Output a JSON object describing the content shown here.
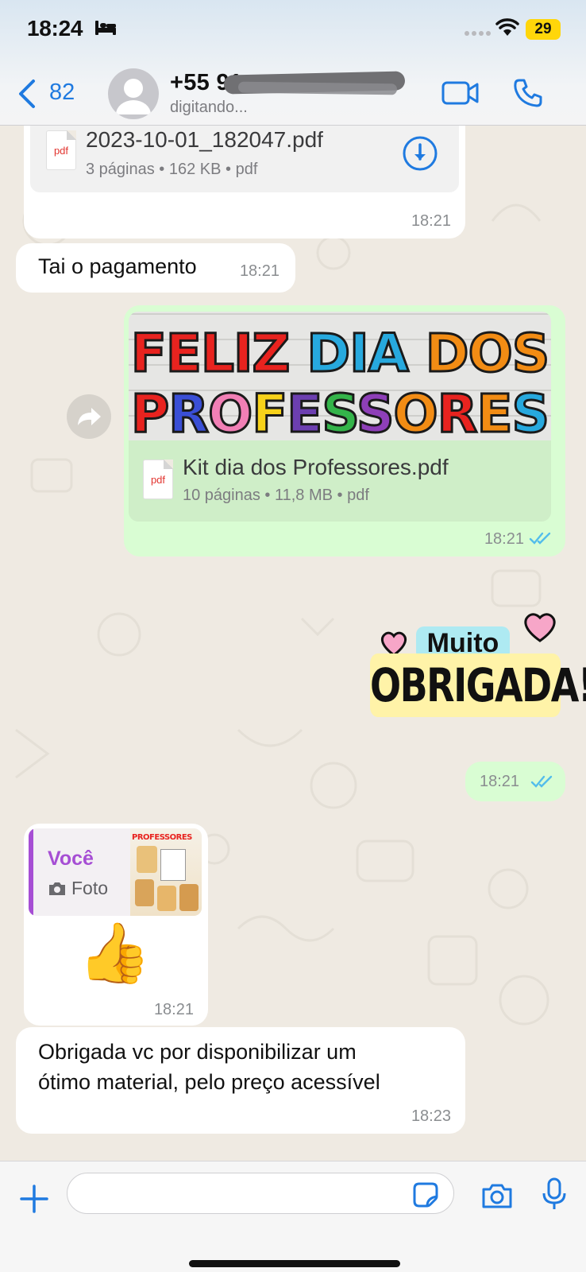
{
  "status_bar": {
    "time": "18:24",
    "battery": "29"
  },
  "header": {
    "back_count": "82",
    "contact_name": "+55 91",
    "contact_status": "digitando..."
  },
  "messages": {
    "file1": {
      "name": "2023-10-01_182047.pdf",
      "meta": "3 páginas • 162 KB • pdf",
      "icon_label": "pdf",
      "time": "18:21"
    },
    "text1": {
      "text": "Tai o pagamento",
      "time": "18:21"
    },
    "banner": {
      "line1": [
        "FELIZ",
        "DIA",
        "DOS"
      ],
      "line2": [
        "P",
        "R",
        "O",
        "F",
        "E",
        "S",
        "S",
        "O",
        "R",
        "E",
        "S"
      ]
    },
    "file2": {
      "name": "Kit dia dos Professores.pdf",
      "meta": "10 páginas • 11,8 MB • pdf",
      "icon_label": "pdf",
      "time": "18:21"
    },
    "sticker": {
      "word1": "Muito",
      "word2": "OBRIGADA!",
      "time": "18:21"
    },
    "reply": {
      "author": "Você",
      "type": "Foto",
      "thumb_title": "PROFESSORES",
      "emoji": "👍",
      "time": "18:21"
    },
    "text2": {
      "line1": "Obrigada vc por disponibilizar um",
      "line2": "ótimo material,  pelo preço acessível",
      "time": "18:23"
    }
  },
  "input": {
    "placeholder": ""
  },
  "colors": {
    "accent": "#1f7ae0",
    "outgoing": "#d9fdd3",
    "incoming": "#ffffff",
    "read_ticks": "#53bdeb",
    "author": "#a64ed4",
    "background": "#efeae2"
  }
}
